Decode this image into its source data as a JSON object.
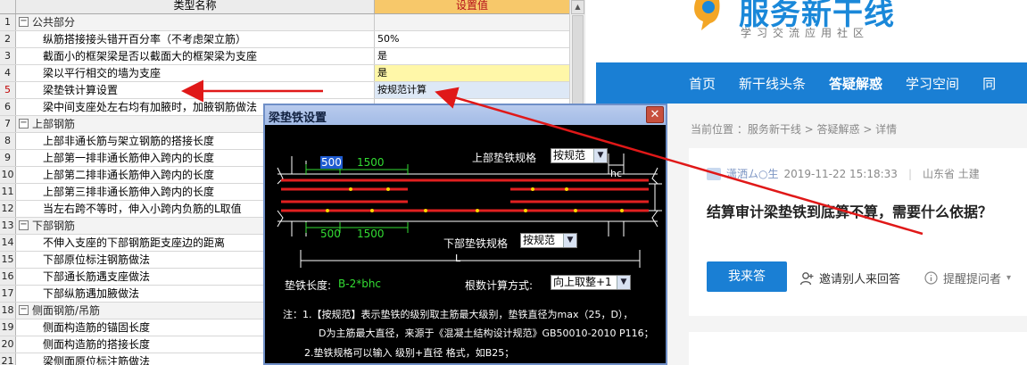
{
  "grid": {
    "header": {
      "name_col": "类型名称",
      "value_col": "设置值"
    },
    "rows": [
      {
        "n": "1",
        "name": "公共部分",
        "value": "",
        "group": true
      },
      {
        "n": "2",
        "name": "纵筋搭接接头错开百分率（不考虑架立筋）",
        "value": "50%"
      },
      {
        "n": "3",
        "name": "截面小的框架梁是否以截面大的框架梁为支座",
        "value": "是"
      },
      {
        "n": "4",
        "name": "梁以平行相交的墙为支座",
        "value": "是",
        "highlight": true
      },
      {
        "n": "5",
        "name": "梁垫铁计算设置",
        "value": "按规范计算",
        "selected": true
      },
      {
        "n": "6",
        "name": "梁中间支座处左右均有加腋时，加腋钢筋做法",
        "value": ""
      },
      {
        "n": "7",
        "name": "上部钢筋",
        "value": "",
        "group": true
      },
      {
        "n": "8",
        "name": "上部非通长筋与架立钢筋的搭接长度",
        "value": ""
      },
      {
        "n": "9",
        "name": "上部第一排非通长筋伸入跨内的长度",
        "value": ""
      },
      {
        "n": "10",
        "name": "上部第二排非通长筋伸入跨内的长度",
        "value": ""
      },
      {
        "n": "11",
        "name": "上部第三排非通长筋伸入跨内的长度",
        "value": ""
      },
      {
        "n": "12",
        "name": "当左右跨不等时，伸入小跨内负筋的L取值",
        "value": ""
      },
      {
        "n": "13",
        "name": "下部钢筋",
        "value": "",
        "group": true
      },
      {
        "n": "14",
        "name": "不伸入支座的下部钢筋距支座边的距离",
        "value": ""
      },
      {
        "n": "15",
        "name": "下部原位标注钢筋做法",
        "value": ""
      },
      {
        "n": "16",
        "name": "下部通长筋遇支座做法",
        "value": ""
      },
      {
        "n": "17",
        "name": "下部纵筋遇加腋做法",
        "value": ""
      },
      {
        "n": "18",
        "name": "侧面钢筋/吊筋",
        "value": "",
        "group": true
      },
      {
        "n": "19",
        "name": "侧面构造筋的锚固长度",
        "value": ""
      },
      {
        "n": "20",
        "name": "侧面构造筋的搭接长度",
        "value": ""
      },
      {
        "n": "21",
        "name": "梁侧面原位标注筋做法",
        "value": ""
      }
    ]
  },
  "dialog": {
    "title": "梁垫铁设置",
    "close_label": "✕",
    "top_spec_label": "上部垫铁规格",
    "top_spec_value": "按规范",
    "bottom_spec_label": "下部垫铁规格",
    "bottom_spec_value": "按规范",
    "dim_500_top": "500",
    "dim_1500_top": "1500",
    "dim_500_bottom": "500",
    "dim_1500_bottom": "1500",
    "dim_hc": "hc",
    "dim_L": "L",
    "length_label": "垫铁长度:",
    "length_formula": "B-2*bhc",
    "count_label": "根数计算方式:",
    "count_value": "向上取整+1",
    "note1": "注：1.【按规范】表示垫铁的级别取主筋最大级别，垫铁直径为max（25，D），",
    "note2": "D为主筋最大直径，来源于《混凝土结构设计规范》GB50010-2010 P116；",
    "note3": "2.垫铁规格可以输入 级别+直径 格式，如B25；"
  },
  "web": {
    "logo_text": "服务新干线",
    "logo_sub": "学习交流应用社区",
    "nav": [
      {
        "label": "首页"
      },
      {
        "label": "新干线头条"
      },
      {
        "label": "答疑解惑",
        "active": true
      },
      {
        "label": "学习空间"
      },
      {
        "label": "同"
      }
    ],
    "breadcrumb": "当前位置 ：服务新干线 > 答疑解惑 > 详情",
    "user_name": "潇洒ム○生",
    "post_time": "2019-11-22 15:18:33",
    "location": "山东省 土建",
    "question": "结算审计梁垫铁到底算不算，需要什么依据？",
    "answer_button": "我来答",
    "invite_label": "邀请别人来回答",
    "remind_label": "提醒提问者"
  },
  "colors": {
    "nav_blue": "#1a7fd4",
    "logo_blue": "#1a88d9",
    "dim_green": "#33dd33",
    "rebar_red": "#e02020",
    "arrow_red": "#e01818"
  }
}
